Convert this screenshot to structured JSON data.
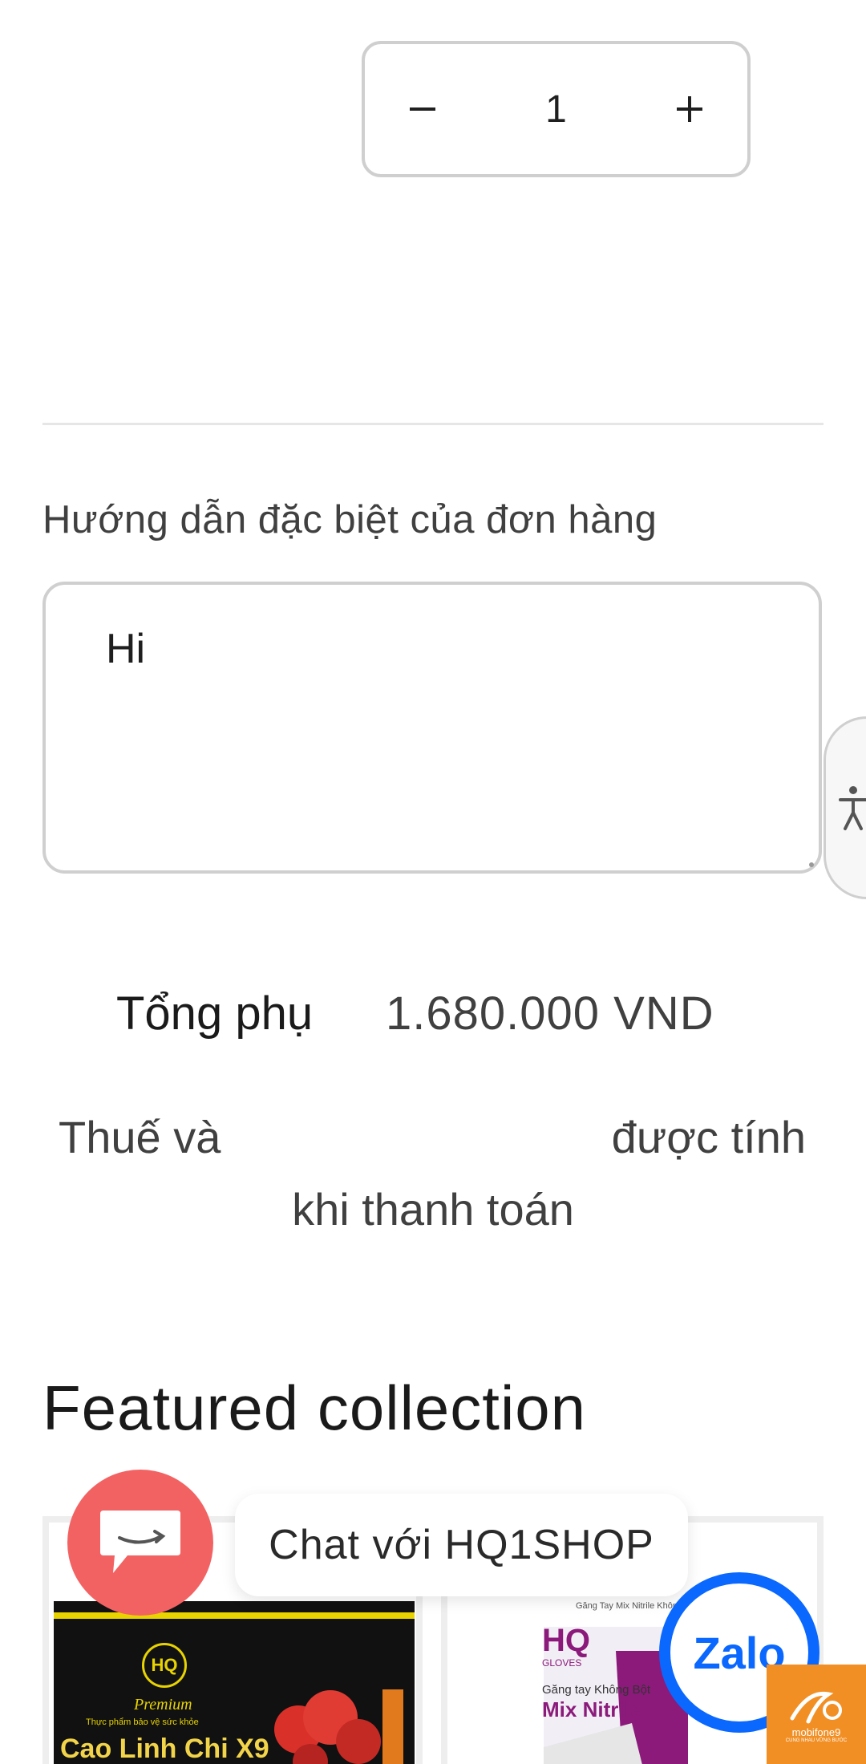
{
  "quantity": {
    "minus_icon": "minus-icon",
    "plus_icon": "plus-icon",
    "value": "1"
  },
  "order_note": {
    "label": "Hướng dẫn đặc biệt của đơn hàng",
    "value": "Hi"
  },
  "accessibility": {
    "icon": "accessibility-icon"
  },
  "totals": {
    "subtotal_label": "Tổng phụ",
    "subtotal_value": "1.680.000 VND",
    "tax_left": "Thuế và",
    "tax_right": "được tính",
    "tax_bottom": "khi thanh toán"
  },
  "featured": {
    "title": "Featured collection",
    "products": [
      {
        "brand": "HQ",
        "line1": "Premium",
        "line2": "Thực phẩm bảo vệ sức khỏe",
        "name": "Cao Linh Chi X9"
      },
      {
        "header": "Găng Tay Mix Nitrile Không",
        "brand": "HQ",
        "brand_sub": "GLOVES",
        "line1": "Găng tay Không Bột",
        "name": "Mix Nitrile"
      }
    ]
  },
  "chat": {
    "label": "Chat với HQ1SHOP"
  },
  "zalo": {
    "label": "Zalo"
  },
  "mobifone": {
    "label": "mobifone9",
    "sub": "CUNG NHAU VỮNG BƯỚC"
  },
  "colors": {
    "chat_red": "#f36262",
    "zalo_blue": "#0a68ff",
    "mobifone_orange": "#f28f24"
  }
}
